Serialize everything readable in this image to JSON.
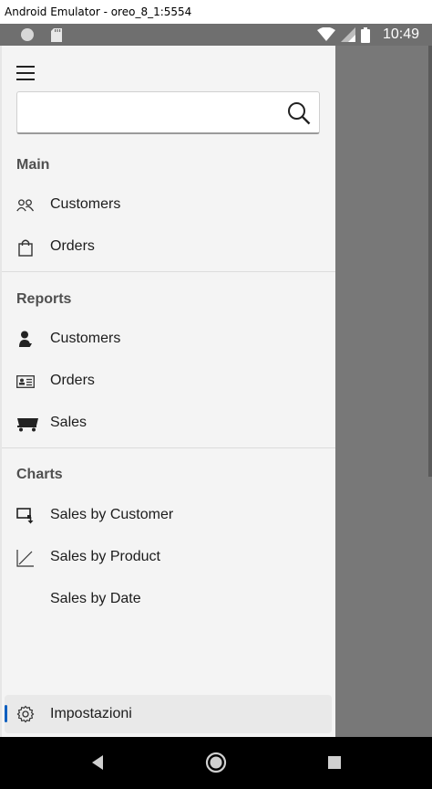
{
  "window": {
    "title": "Android Emulator - oreo_8_1:5554"
  },
  "status_bar": {
    "time": "10:49"
  },
  "search": {
    "value": "",
    "placeholder": ""
  },
  "sections": {
    "main": {
      "title": "Main",
      "items": [
        {
          "label": "Customers",
          "icon": "people-icon"
        },
        {
          "label": "Orders",
          "icon": "shopping-bag-icon"
        }
      ]
    },
    "reports": {
      "title": "Reports",
      "items": [
        {
          "label": "Customers",
          "icon": "person-report-icon"
        },
        {
          "label": "Orders",
          "icon": "id-card-icon"
        },
        {
          "label": "Sales",
          "icon": "cart-icon"
        }
      ]
    },
    "charts": {
      "title": "Charts",
      "items": [
        {
          "label": "Sales by Customer",
          "icon": "chart-download-icon"
        },
        {
          "label": "Sales by Product",
          "icon": "line-chart-icon"
        },
        {
          "label": "Sales by Date",
          "icon": ""
        }
      ]
    }
  },
  "settings": {
    "label": "Impostazioni",
    "icon": "gear-icon"
  },
  "colors": {
    "accent": "#0f5fbf",
    "drawer_bg": "#f4f4f4",
    "scrim": "#787878",
    "status_bar": "#6f6f6f"
  }
}
